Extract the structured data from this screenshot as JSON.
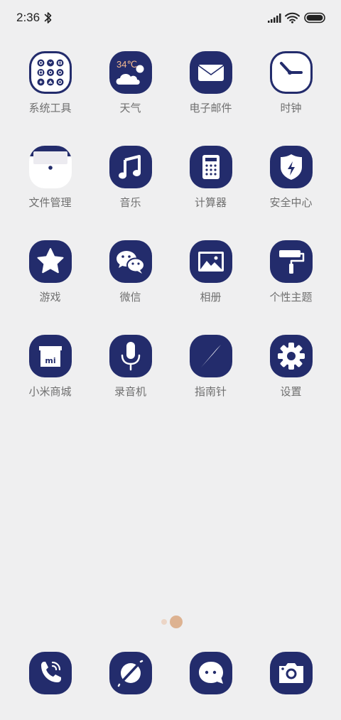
{
  "status": {
    "time": "2:36",
    "icons": [
      "bluetooth-icon",
      "signal-icon",
      "wifi-icon",
      "battery-icon"
    ]
  },
  "colors": {
    "icon_bg": "#232c6c",
    "label": "#6f6f6f",
    "page_bg": "#efeff0",
    "weather_text": "#f3b98f",
    "indicator_active": "#ddb291",
    "indicator_inactive": "#ecd5c6"
  },
  "apps": [
    {
      "label": "系统工具",
      "icon": "tools-folder-icon"
    },
    {
      "label": "天气",
      "icon": "weather-cloud-icon",
      "temp": "34℃"
    },
    {
      "label": "电子邮件",
      "icon": "mail-envelope-icon"
    },
    {
      "label": "时钟",
      "icon": "clock-icon"
    },
    {
      "label": "文件管理",
      "icon": "folder-icon"
    },
    {
      "label": "音乐",
      "icon": "music-note-icon"
    },
    {
      "label": "计算器",
      "icon": "calculator-icon"
    },
    {
      "label": "安全中心",
      "icon": "shield-bolt-icon"
    },
    {
      "label": "游戏",
      "icon": "star-icon"
    },
    {
      "label": "微信",
      "icon": "wechat-icon"
    },
    {
      "label": "相册",
      "icon": "picture-icon"
    },
    {
      "label": "个性主题",
      "icon": "paint-roller-icon"
    },
    {
      "label": "小米商城",
      "icon": "mi-store-icon",
      "badge_text": "mi"
    },
    {
      "label": "录音机",
      "icon": "microphone-icon"
    },
    {
      "label": "指南针",
      "icon": "compass-icon"
    },
    {
      "label": "设置",
      "icon": "gear-icon"
    }
  ],
  "dock": [
    {
      "icon": "phone-icon"
    },
    {
      "icon": "browser-icon"
    },
    {
      "icon": "messages-icon"
    },
    {
      "icon": "camera-icon"
    }
  ],
  "page_indicator": {
    "pages": 2,
    "active": 2
  }
}
